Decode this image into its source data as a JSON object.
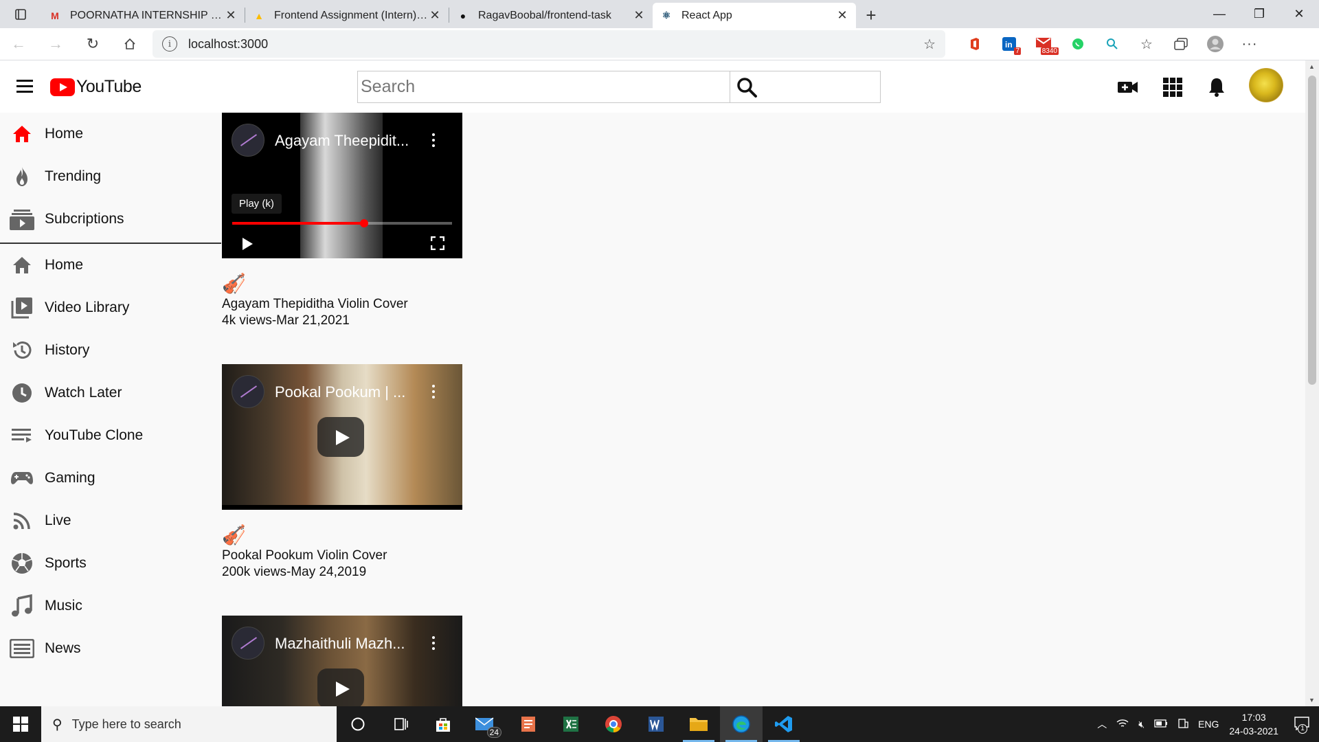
{
  "browser": {
    "tabs": [
      {
        "title": "POORNATHA INTERNSHIP DRIVE",
        "favicon_letter": "M",
        "favicon_color": "#d93025",
        "active": false
      },
      {
        "title": "Frontend Assignment (Intern) | P",
        "favicon_letter": "▲",
        "favicon_color": "#fbbc04",
        "active": false
      },
      {
        "title": "RagavBoobal/frontend-task",
        "favicon_letter": "●",
        "favicon_color": "#111111",
        "active": false
      },
      {
        "title": "React App",
        "favicon_letter": "⚛",
        "favicon_color": "#1d4e6f",
        "active": true
      }
    ],
    "url": "localhost:3000",
    "extension_badges": {
      "linkedin": "7",
      "mail": "8340"
    }
  },
  "header": {
    "logo_text": "YouTube",
    "search_placeholder": "Search",
    "brand_color": "#ff0000"
  },
  "sidebar": {
    "primary": [
      {
        "label": "Home",
        "icon": "home-icon",
        "active_color": "#ff0000"
      },
      {
        "label": "Trending",
        "icon": "fire-icon"
      },
      {
        "label": "Subcriptions",
        "icon": "subscriptions-icon"
      }
    ],
    "secondary": [
      {
        "label": "Home",
        "icon": "home-icon"
      },
      {
        "label": "Video Library",
        "icon": "video-library-icon"
      },
      {
        "label": "History",
        "icon": "history-icon"
      },
      {
        "label": "Watch Later",
        "icon": "clock-icon"
      },
      {
        "label": "YouTube Clone",
        "icon": "playlist-icon"
      },
      {
        "label": "Gaming",
        "icon": "gamepad-icon"
      },
      {
        "label": "Live",
        "icon": "live-icon"
      },
      {
        "label": "Sports",
        "icon": "soccer-ball-icon"
      },
      {
        "label": "Music",
        "icon": "music-note-icon"
      },
      {
        "label": "News",
        "icon": "news-icon"
      }
    ]
  },
  "videos": [
    {
      "embed_title": "Agayam Theepidit...",
      "title": "Agayam Thepiditha Violin Cover",
      "views_date": "4k views-Mar 21,2021",
      "tooltip": "Play (k)",
      "progress": 0.6
    },
    {
      "embed_title": "Pookal Pookum | ...",
      "title": "Pookal Pookum Violin Cover",
      "views_date": "200k views-May 24,2019"
    },
    {
      "embed_title": "Mazhaithuli Mazh...",
      "title": "",
      "views_date": ""
    }
  ],
  "taskbar": {
    "search_placeholder": "Type here to search",
    "mail_badge": "24",
    "language": "ENG",
    "time": "17:03",
    "date": "24-03-2021",
    "notification_count": "1"
  }
}
